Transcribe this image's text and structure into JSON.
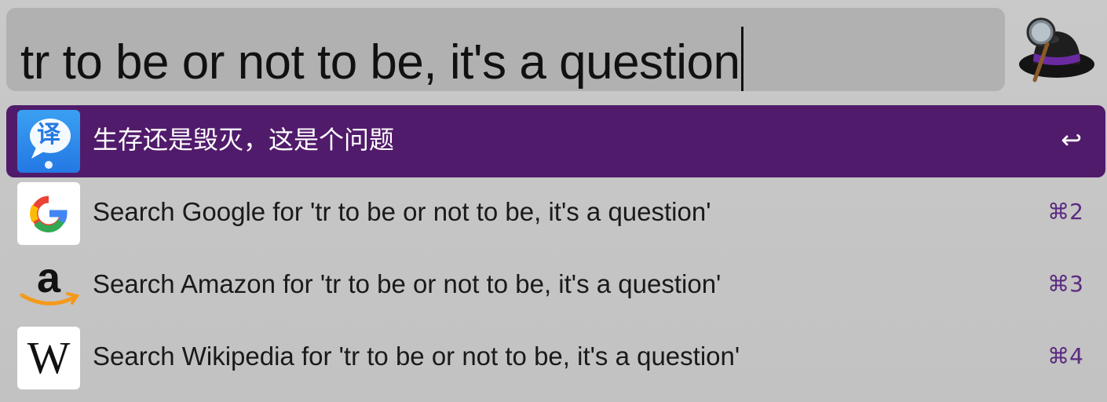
{
  "search": {
    "query": "tr to be or not to be, it's a question"
  },
  "app": {
    "logo_icon": "alfred-hat-icon"
  },
  "colors": {
    "selection": "#511b6b",
    "shortcut": "#5b2a80",
    "search_box": "#b1b1b1",
    "panel": "#c6c6c6"
  },
  "results": [
    {
      "icon": "translate-icon",
      "icon_glyph": "译",
      "title": "生存还是毁灭，这是个问题",
      "shortcut": "↩",
      "selected": true
    },
    {
      "icon": "google-icon",
      "title": "Search Google for 'tr to be or not to be, it's a question'",
      "shortcut": "⌘2",
      "selected": false
    },
    {
      "icon": "amazon-icon",
      "title": "Search Amazon for 'tr to be or not to be, it's a question'",
      "shortcut": "⌘3",
      "selected": false
    },
    {
      "icon": "wikipedia-icon",
      "icon_glyph": "W",
      "title": "Search Wikipedia for 'tr to be or not to be, it's a question'",
      "shortcut": "⌘4",
      "selected": false
    }
  ]
}
